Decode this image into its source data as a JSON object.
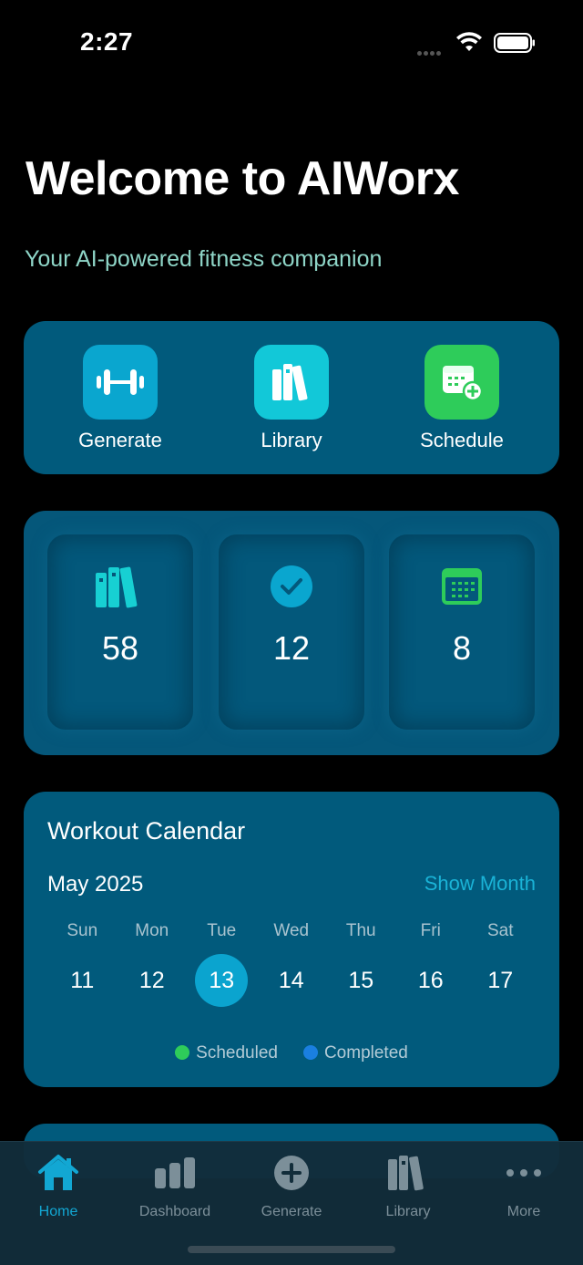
{
  "status": {
    "time": "2:27"
  },
  "header": {
    "title": "Welcome to AIWorx",
    "subtitle": "Your AI-powered fitness companion"
  },
  "actions": [
    {
      "label": "Generate",
      "icon": "dumbbell-icon",
      "color": "#0aa6cf"
    },
    {
      "label": "Library",
      "icon": "books-icon",
      "color": "#12c8d8"
    },
    {
      "label": "Schedule",
      "icon": "calendar-add-icon",
      "color": "#2ecc5a"
    }
  ],
  "stats": [
    {
      "value": "58",
      "icon": "books-icon",
      "color": "#17d0d3"
    },
    {
      "value": "12",
      "icon": "checkmark-icon",
      "color": "#0aa6cf"
    },
    {
      "value": "8",
      "icon": "calendar-icon",
      "color": "#2ecc5a"
    }
  ],
  "calendar": {
    "title": "Workout Calendar",
    "month": "May 2025",
    "show_month": "Show Month",
    "days": [
      "Sun",
      "Mon",
      "Tue",
      "Wed",
      "Thu",
      "Fri",
      "Sat"
    ],
    "dates": [
      "11",
      "12",
      "13",
      "14",
      "15",
      "16",
      "17"
    ],
    "selected": "13",
    "legend": [
      {
        "label": "Scheduled",
        "color": "#2ecc5a"
      },
      {
        "label": "Completed",
        "color": "#1a7fe0"
      }
    ]
  },
  "tabbar": [
    {
      "label": "Home",
      "icon": "home-icon",
      "active": true
    },
    {
      "label": "Dashboard",
      "icon": "chart-icon",
      "active": false
    },
    {
      "label": "Generate",
      "icon": "plus-circle-icon",
      "active": false
    },
    {
      "label": "Library",
      "icon": "books-icon",
      "active": false
    },
    {
      "label": "More",
      "icon": "more-icon",
      "active": false
    }
  ]
}
